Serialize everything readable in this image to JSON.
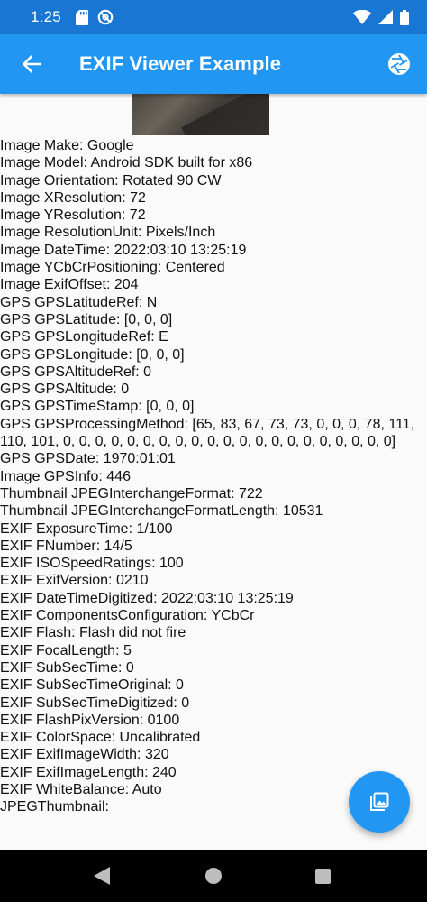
{
  "status_bar": {
    "time": "1:25",
    "icons": [
      "sd-card-icon",
      "no-disturb-icon",
      "wifi-icon",
      "signal-icon",
      "battery-icon"
    ]
  },
  "app_bar": {
    "title": "EXIF Viewer Example",
    "back_icon": "arrow-back-icon",
    "action_icon": "camera-shutter-icon",
    "color": "#2196f3",
    "status_color": "#1976d2"
  },
  "exif_lines": [
    "Image Make: Google",
    "Image Model: Android SDK built for x86",
    "Image Orientation: Rotated 90 CW",
    "Image XResolution: 72",
    "Image YResolution: 72",
    "Image ResolutionUnit: Pixels/Inch",
    "Image DateTime: 2022:03:10 13:25:19",
    "Image YCbCrPositioning: Centered",
    "Image ExifOffset: 204",
    "GPS GPSLatitudeRef: N",
    "GPS GPSLatitude: [0, 0, 0]",
    "GPS GPSLongitudeRef: E",
    "GPS GPSLongitude: [0, 0, 0]",
    "GPS GPSAltitudeRef: 0",
    "GPS GPSAltitude: 0",
    "GPS GPSTimeStamp: [0, 0, 0]",
    "GPS GPSProcessingMethod: [65, 83, 67, 73, 73, 0, 0, 0, 78, 111, 110, 101, 0, 0, 0, 0, 0, 0, 0, 0, 0, 0, 0, 0, 0, 0, 0, 0, 0, 0, 0, 0, 0]",
    "GPS GPSDate: 1970:01:01",
    "Image GPSInfo: 446",
    "Thumbnail JPEGInterchangeFormat: 722",
    "Thumbnail JPEGInterchangeFormatLength: 10531",
    "EXIF ExposureTime: 1/100",
    "EXIF FNumber: 14/5",
    "EXIF ISOSpeedRatings: 100",
    "EXIF ExifVersion: 0210",
    "EXIF DateTimeDigitized: 2022:03:10 13:25:19",
    "EXIF ComponentsConfiguration: YCbCr",
    "EXIF Flash: Flash did not fire",
    "EXIF FocalLength: 5",
    "EXIF SubSecTime: 0",
    "EXIF SubSecTimeOriginal: 0",
    "EXIF SubSecTimeDigitized: 0",
    "EXIF FlashPixVersion: 0100",
    "EXIF ColorSpace: Uncalibrated",
    "EXIF ExifImageWidth: 320",
    "EXIF ExifImageLength: 240",
    "EXIF WhiteBalance: Auto",
    "JPEGThumbnail:"
  ],
  "fab": {
    "icon": "photo-library-icon"
  },
  "nav_bar": {
    "icons": [
      "nav-back-icon",
      "nav-home-icon",
      "nav-recents-icon"
    ]
  }
}
